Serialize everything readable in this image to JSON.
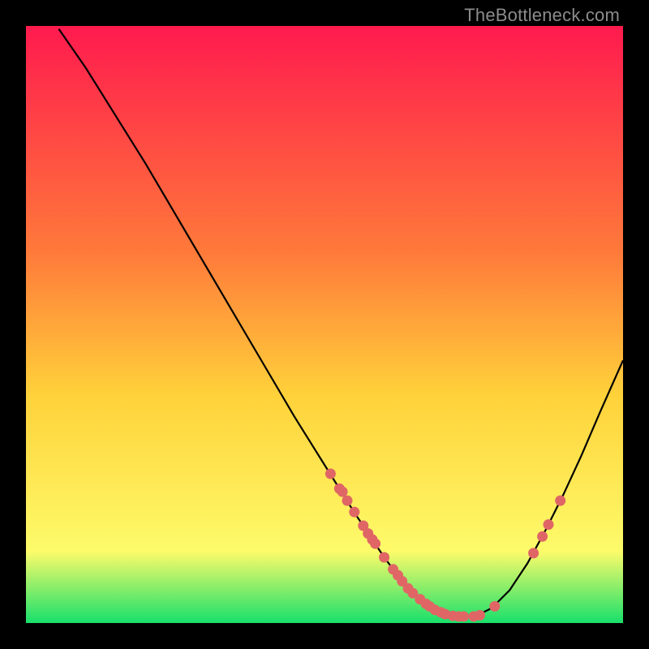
{
  "watermark": "TheBottleneck.com",
  "colors": {
    "black": "#000000",
    "curve": "#000000",
    "point": "#e06666",
    "grad_top": "#ff1a4e",
    "grad_mid1": "#ff7a3a",
    "grad_mid2": "#ffd23a",
    "grad_mid3": "#fdfb6a",
    "grad_bot": "#18e06b"
  },
  "chart_data": {
    "type": "line",
    "title": "",
    "xlabel": "",
    "ylabel": "",
    "x_range": [
      0,
      100
    ],
    "y_range": [
      0,
      100
    ],
    "curve": [
      {
        "x": 5.5,
        "y": 99.5
      },
      {
        "x": 10,
        "y": 93
      },
      {
        "x": 15,
        "y": 85
      },
      {
        "x": 20,
        "y": 77
      },
      {
        "x": 25,
        "y": 68.5
      },
      {
        "x": 30,
        "y": 60
      },
      {
        "x": 35,
        "y": 51.5
      },
      {
        "x": 40,
        "y": 43
      },
      {
        "x": 45,
        "y": 34.5
      },
      {
        "x": 50,
        "y": 26.5
      },
      {
        "x": 55,
        "y": 18.5
      },
      {
        "x": 60,
        "y": 11
      },
      {
        "x": 63,
        "y": 7
      },
      {
        "x": 66,
        "y": 4
      },
      {
        "x": 69,
        "y": 2
      },
      {
        "x": 72,
        "y": 1.1
      },
      {
        "x": 75,
        "y": 1.0
      },
      {
        "x": 78,
        "y": 2.5
      },
      {
        "x": 81,
        "y": 5.5
      },
      {
        "x": 84,
        "y": 10
      },
      {
        "x": 87,
        "y": 15.5
      },
      {
        "x": 90,
        "y": 21.5
      },
      {
        "x": 93,
        "y": 28
      },
      {
        "x": 96,
        "y": 35
      },
      {
        "x": 100,
        "y": 44
      }
    ],
    "points": [
      {
        "x": 51.0,
        "y": 25.0
      },
      {
        "x": 52.5,
        "y": 22.5
      },
      {
        "x": 53.0,
        "y": 22.0
      },
      {
        "x": 53.8,
        "y": 20.5
      },
      {
        "x": 55.0,
        "y": 18.6
      },
      {
        "x": 56.5,
        "y": 16.3
      },
      {
        "x": 57.3,
        "y": 15.0
      },
      {
        "x": 58.0,
        "y": 14.0
      },
      {
        "x": 58.5,
        "y": 13.3
      },
      {
        "x": 60.0,
        "y": 11.0
      },
      {
        "x": 61.5,
        "y": 9.0
      },
      {
        "x": 62.3,
        "y": 8.0
      },
      {
        "x": 63.0,
        "y": 7.0
      },
      {
        "x": 64.0,
        "y": 5.8
      },
      {
        "x": 64.8,
        "y": 5.0
      },
      {
        "x": 66.0,
        "y": 4.0
      },
      {
        "x": 67.0,
        "y": 3.2
      },
      {
        "x": 67.6,
        "y": 2.8
      },
      {
        "x": 68.5,
        "y": 2.2
      },
      {
        "x": 69.5,
        "y": 1.8
      },
      {
        "x": 70.2,
        "y": 1.5
      },
      {
        "x": 71.5,
        "y": 1.2
      },
      {
        "x": 72.5,
        "y": 1.1
      },
      {
        "x": 73.3,
        "y": 1.1
      },
      {
        "x": 75.0,
        "y": 1.1
      },
      {
        "x": 76.0,
        "y": 1.3
      },
      {
        "x": 78.5,
        "y": 2.8
      },
      {
        "x": 85.0,
        "y": 11.7
      },
      {
        "x": 86.5,
        "y": 14.5
      },
      {
        "x": 87.5,
        "y": 16.5
      },
      {
        "x": 89.5,
        "y": 20.5
      }
    ]
  }
}
